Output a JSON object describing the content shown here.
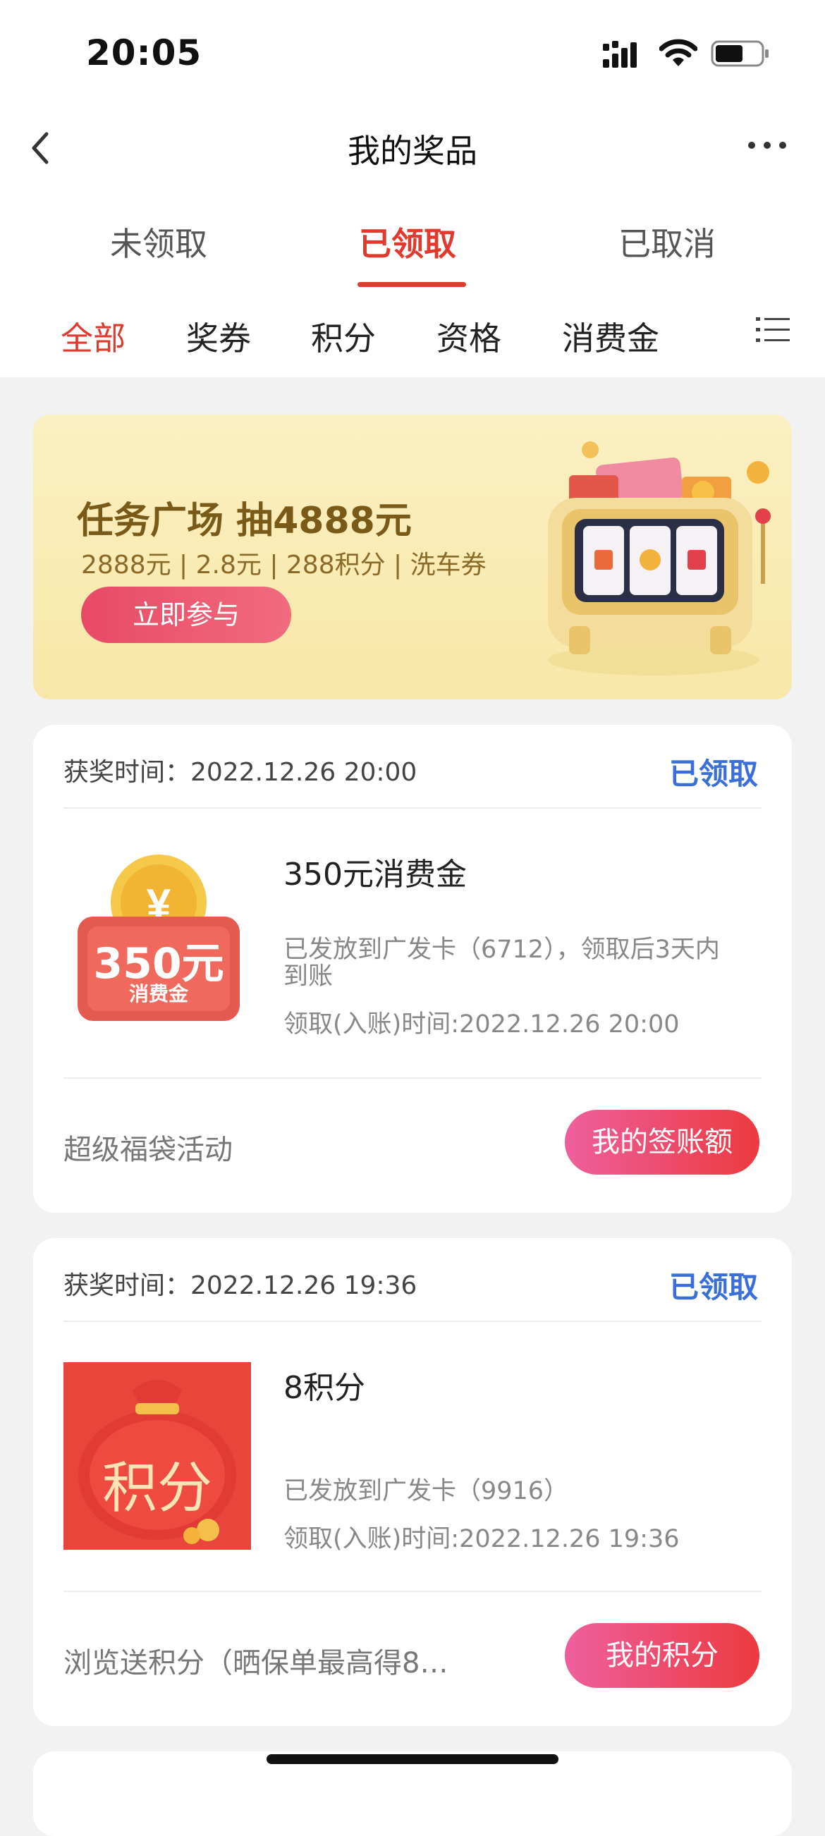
{
  "status": {
    "time": "20:05"
  },
  "nav": {
    "title": "我的奖品"
  },
  "segments": [
    {
      "label": "未领取"
    },
    {
      "label": "已领取"
    },
    {
      "label": "已取消"
    }
  ],
  "categories": [
    {
      "label": "全部"
    },
    {
      "label": "奖券"
    },
    {
      "label": "积分"
    },
    {
      "label": "资格"
    },
    {
      "label": "消费金"
    }
  ],
  "banner": {
    "title": "任务广场 抽4888元",
    "subtitle": "2888元 | 2.8元 | 288积分 | 洗车券",
    "button": "立即参与"
  },
  "prizes": [
    {
      "award_time": "获奖时间：2022.12.26 20:00",
      "status": "已领取",
      "name": "350元消费金",
      "desc": "已发放到广发卡（6712），领取后3天内到账",
      "claim_time": "领取(入账)时间:2022.12.26 20:00",
      "activity": "超级福袋活动",
      "button": "我的签账额",
      "thumb_amount": "350元",
      "thumb_label": "消费金"
    },
    {
      "award_time": "获奖时间：2022.12.26 19:36",
      "status": "已领取",
      "name": "8积分",
      "desc": "已发放到广发卡（9916）",
      "claim_time": "领取(入账)时间:2022.12.26 19:36",
      "activity": "浏览送积分（晒保单最高得8…",
      "button": "我的积分",
      "thumb_label": "积分"
    }
  ],
  "colors": {
    "accent": "#e03a2e",
    "status_blue": "#3a6fd8"
  }
}
